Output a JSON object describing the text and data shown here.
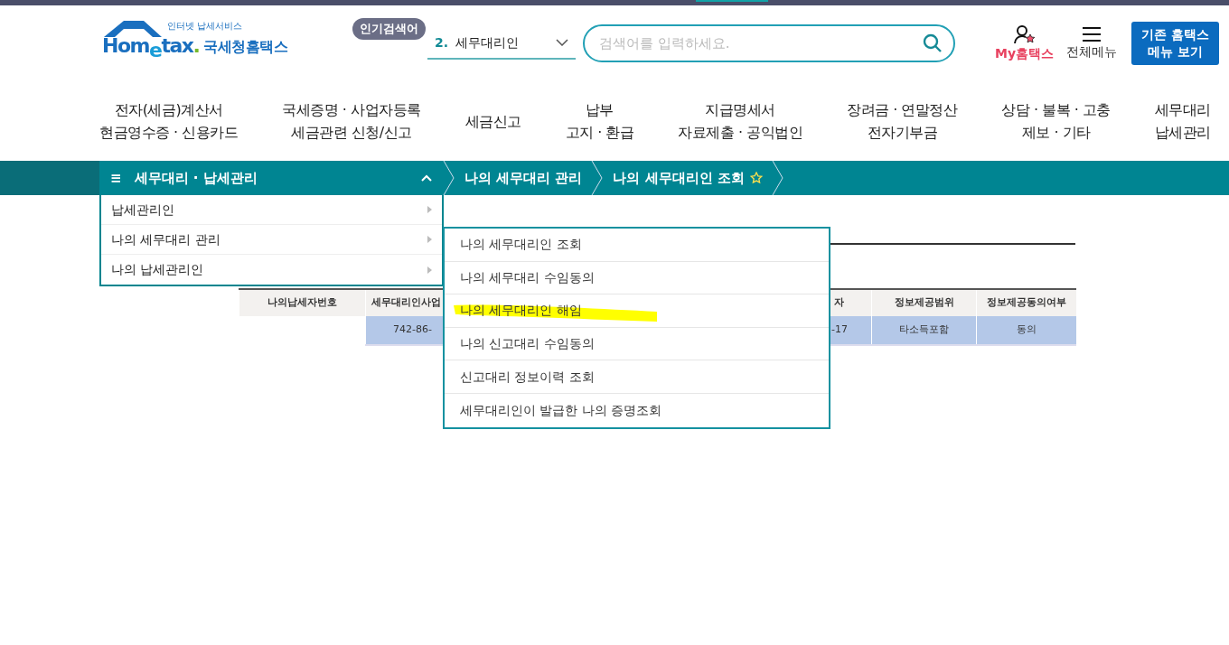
{
  "logo": {
    "tagline": "인터넷 납세서비스",
    "wordmark_home": "Hom",
    "wordmark_e": "e",
    "wordmark_tax": "tax",
    "wordmark_dot": ".",
    "name": "국세청홈택스"
  },
  "popular": {
    "badge": "인기검색어",
    "rank": "2.",
    "term": "세무대리인"
  },
  "search": {
    "placeholder": "검색어를 입력하세요."
  },
  "header_links": [
    {
      "kind": "my",
      "label": "My홈택스"
    },
    {
      "kind": "menu",
      "label": "전체메뉴"
    }
  ],
  "legacy_button": {
    "line1": "기존 홈택스",
    "line2": "메뉴 보기"
  },
  "nav": [
    {
      "lines": [
        "전자(세금)계산서",
        "현금영수증 · 신용카드"
      ]
    },
    {
      "lines": [
        "국세증명 · 사업자등록",
        "세금관련 신청/신고"
      ]
    },
    {
      "lines": [
        "세금신고"
      ]
    },
    {
      "lines": [
        "납부",
        "고지 · 환급"
      ]
    },
    {
      "lines": [
        "지급명세서",
        "자료제출 · 공익법인"
      ]
    },
    {
      "lines": [
        "장려금 · 연말정산",
        "전자기부금"
      ]
    },
    {
      "lines": [
        "상담 · 불복 · 고충",
        "제보 · 기타"
      ]
    },
    {
      "lines": [
        "세무대리",
        "납세관리"
      ]
    }
  ],
  "breadcrumb": {
    "menu_icon": "≡",
    "section": "세무대리 · 납세관리",
    "expanded": true,
    "items": [
      {
        "label": "나의 세무대리 관리",
        "favorite": false
      },
      {
        "label": "나의 세무대리인 조회",
        "favorite": true
      }
    ]
  },
  "dropdown": [
    {
      "label": "납세관리인"
    },
    {
      "label": "나의 세무대리 관리"
    },
    {
      "label": "나의 납세관리인"
    }
  ],
  "submenu": [
    {
      "label": "나의 세무대리인 조회",
      "highlighted": false
    },
    {
      "label": "나의 세무대리 수임동의",
      "highlighted": false
    },
    {
      "label": "나의 세무대리인 해임",
      "highlighted": true
    },
    {
      "label": "나의 신고대리 수임동의",
      "highlighted": false
    },
    {
      "label": "신고대리 정보이력 조회",
      "highlighted": false
    },
    {
      "label": "세무대리인이 발급한 나의 증명조회",
      "highlighted": false
    }
  ],
  "table": {
    "columns": [
      "나의납세자번호",
      "세무대리인사업",
      "자",
      "정보제공범위",
      "정보제공동의여부"
    ],
    "rows": [
      {
        "selected": true,
        "cells": [
          "",
          "742-86-",
          "-17",
          "타소득포함",
          "동의"
        ]
      }
    ]
  }
}
